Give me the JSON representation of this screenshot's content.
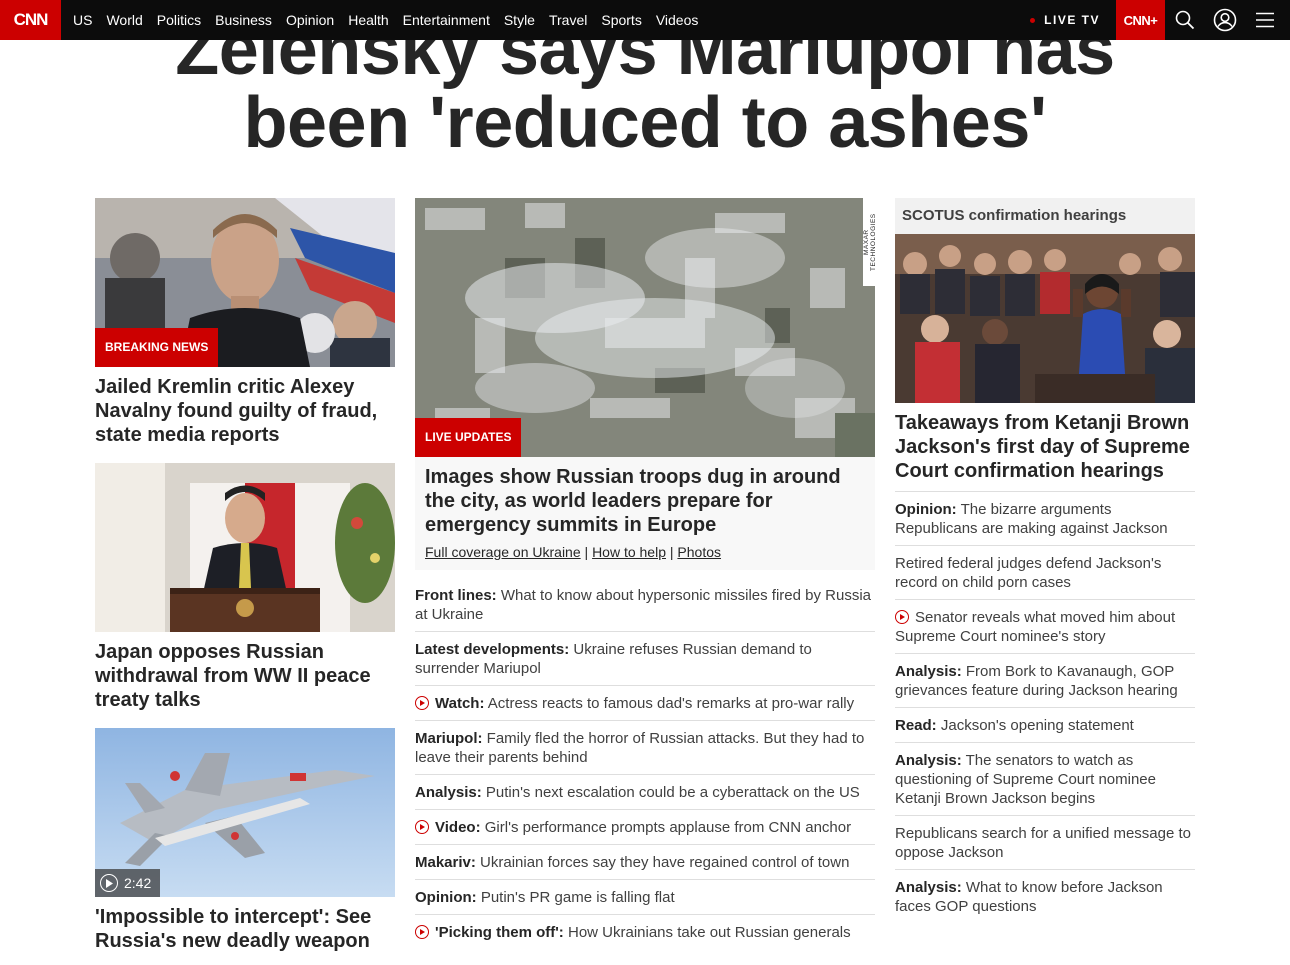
{
  "nav": {
    "logo": "CNN",
    "links": [
      "US",
      "World",
      "Politics",
      "Business",
      "Opinion",
      "Health",
      "Entertainment",
      "Style",
      "Travel",
      "Sports",
      "Videos"
    ],
    "live_tv": "LIVE TV",
    "cnn_plus": "CNN+"
  },
  "headline": {
    "line1": "Zelensky says Mariupol has",
    "line2": "been 'reduced to ashes'"
  },
  "left": [
    {
      "badge": "BREAKING NEWS",
      "title": "Jailed Kremlin critic Alexey Navalny found guilty of fraud, state media reports"
    },
    {
      "title": "Japan opposes Russian withdrawal from WW II peace treaty talks"
    },
    {
      "duration": "2:42",
      "title": "'Impossible to intercept': See Russia's new deadly weapon"
    }
  ],
  "middle": {
    "badge": "LIVE UPDATES",
    "image_credit": "MAXAR TECHNOLOGIES",
    "title": "Images show Russian troops dug in around the city, as world leaders prepare for emergency summits in Europe",
    "links": [
      "Full coverage on Ukraine",
      "How to help",
      "Photos"
    ],
    "link_separator": "|",
    "items": [
      {
        "label": "Front lines:",
        "text": "What to know about hypersonic missiles fired by Russia at Ukraine",
        "video": false
      },
      {
        "label": "Latest developments:",
        "text": "Ukraine refuses Russian demand to surrender Mariupol",
        "video": false
      },
      {
        "label": "Watch:",
        "text": "Actress reacts to famous dad's remarks at pro-war rally",
        "video": true
      },
      {
        "label": "Mariupol:",
        "text": "Family fled the horror of Russian attacks. But they had to leave their parents behind",
        "video": false
      },
      {
        "label": "Analysis:",
        "text": "Putin's next escalation could be a cyberattack on the US",
        "video": false
      },
      {
        "label": "Video:",
        "text": "Girl's performance prompts applause from CNN anchor",
        "video": true
      },
      {
        "label": "Makariv:",
        "text": "Ukrainian forces say they have regained control of town",
        "video": false
      },
      {
        "label": "Opinion:",
        "text": "Putin's PR game is falling flat",
        "video": false
      },
      {
        "label": "'Picking them off':",
        "text": "How Ukrainians take out Russian generals",
        "video": true
      }
    ]
  },
  "right": {
    "section": "SCOTUS confirmation hearings",
    "title": "Takeaways from Ketanji Brown Jackson's first day of Supreme Court confirmation hearings",
    "items": [
      {
        "label": "Opinion:",
        "text": "The bizarre arguments Republicans are making against Jackson",
        "video": false
      },
      {
        "label": "",
        "text": "Retired federal judges defend Jackson's record on child porn cases",
        "video": false
      },
      {
        "label": "",
        "text": "Senator reveals what moved him about Supreme Court nominee's story",
        "video": true
      },
      {
        "label": "Analysis:",
        "text": "From Bork to Kavanaugh, GOP grievances feature during Jackson hearing",
        "video": false
      },
      {
        "label": "Read:",
        "text": "Jackson's opening statement",
        "video": false
      },
      {
        "label": "Analysis:",
        "text": "The senators to watch as questioning of Supreme Court nominee Ketanji Brown Jackson begins",
        "video": false
      },
      {
        "label": "",
        "text": "Republicans search for a unified message to oppose Jackson",
        "video": false
      },
      {
        "label": "Analysis:",
        "text": "What to know before Jackson faces GOP questions",
        "video": false
      }
    ]
  }
}
